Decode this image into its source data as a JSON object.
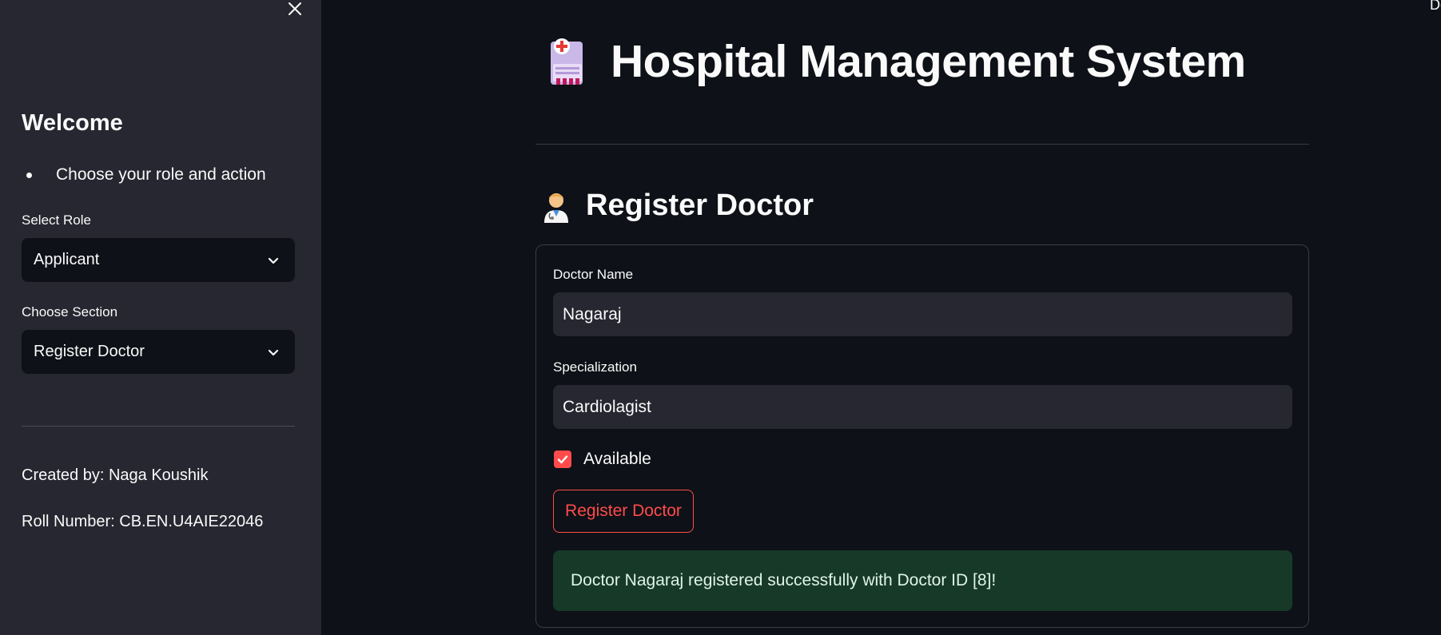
{
  "sidebar": {
    "close_icon": "close-icon",
    "welcome": "Welcome",
    "bullet": "Choose your role and action",
    "role_label": "Select Role",
    "role_value": "Applicant",
    "section_label": "Choose Section",
    "section_value": "Register Doctor",
    "created_by": "Created by: Naga Koushik",
    "roll_number": "Roll Number: CB.EN.U4AIE22046"
  },
  "main": {
    "title": "Hospital Management System",
    "title_icon": "hospital-icon",
    "subtitle": "Register Doctor",
    "subtitle_icon": "doctor-icon",
    "edge_text": "Do",
    "form": {
      "doctor_name_label": "Doctor Name",
      "doctor_name_value": "Nagaraj",
      "specialization_label": "Specialization",
      "specialization_value": "Cardiolagist",
      "available_label": "Available",
      "available_checked": true,
      "submit_label": "Register Doctor"
    },
    "success_message": "Doctor Nagaraj registered successfully with Doctor ID [8]!"
  },
  "colors": {
    "accent": "#ff4b4b",
    "background": "#0e1117",
    "sidebar": "#262730",
    "success_bg": "#173928"
  }
}
